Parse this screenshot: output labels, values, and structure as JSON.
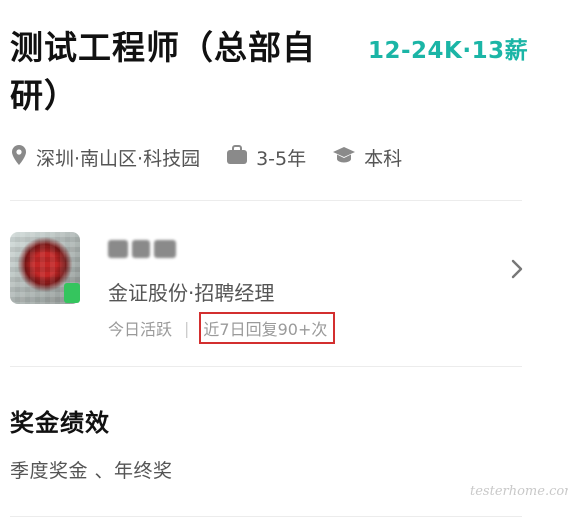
{
  "job": {
    "title": "测试工程师（总部自研）",
    "salary": "12-24K·13薪",
    "location": "深圳·南山区·科技园",
    "experience": "3-5年",
    "education": "本科"
  },
  "recruiter": {
    "company_role": "金证股份·招聘经理",
    "active_status": "今日活跃",
    "separator": "|",
    "reply_rate": "近7日回复90+次"
  },
  "benefits": {
    "title": "奖金绩效",
    "items": "季度奖金 、年终奖"
  },
  "icons": {
    "location": "location-pin-icon",
    "experience": "briefcase-icon",
    "education": "graduation-cap-icon",
    "more": "chevron-right-icon"
  },
  "colors": {
    "salary": "#1bb5a6",
    "highlight_box": "#d32f2f",
    "online": "#35c55e"
  },
  "watermark": "testerhome.com"
}
